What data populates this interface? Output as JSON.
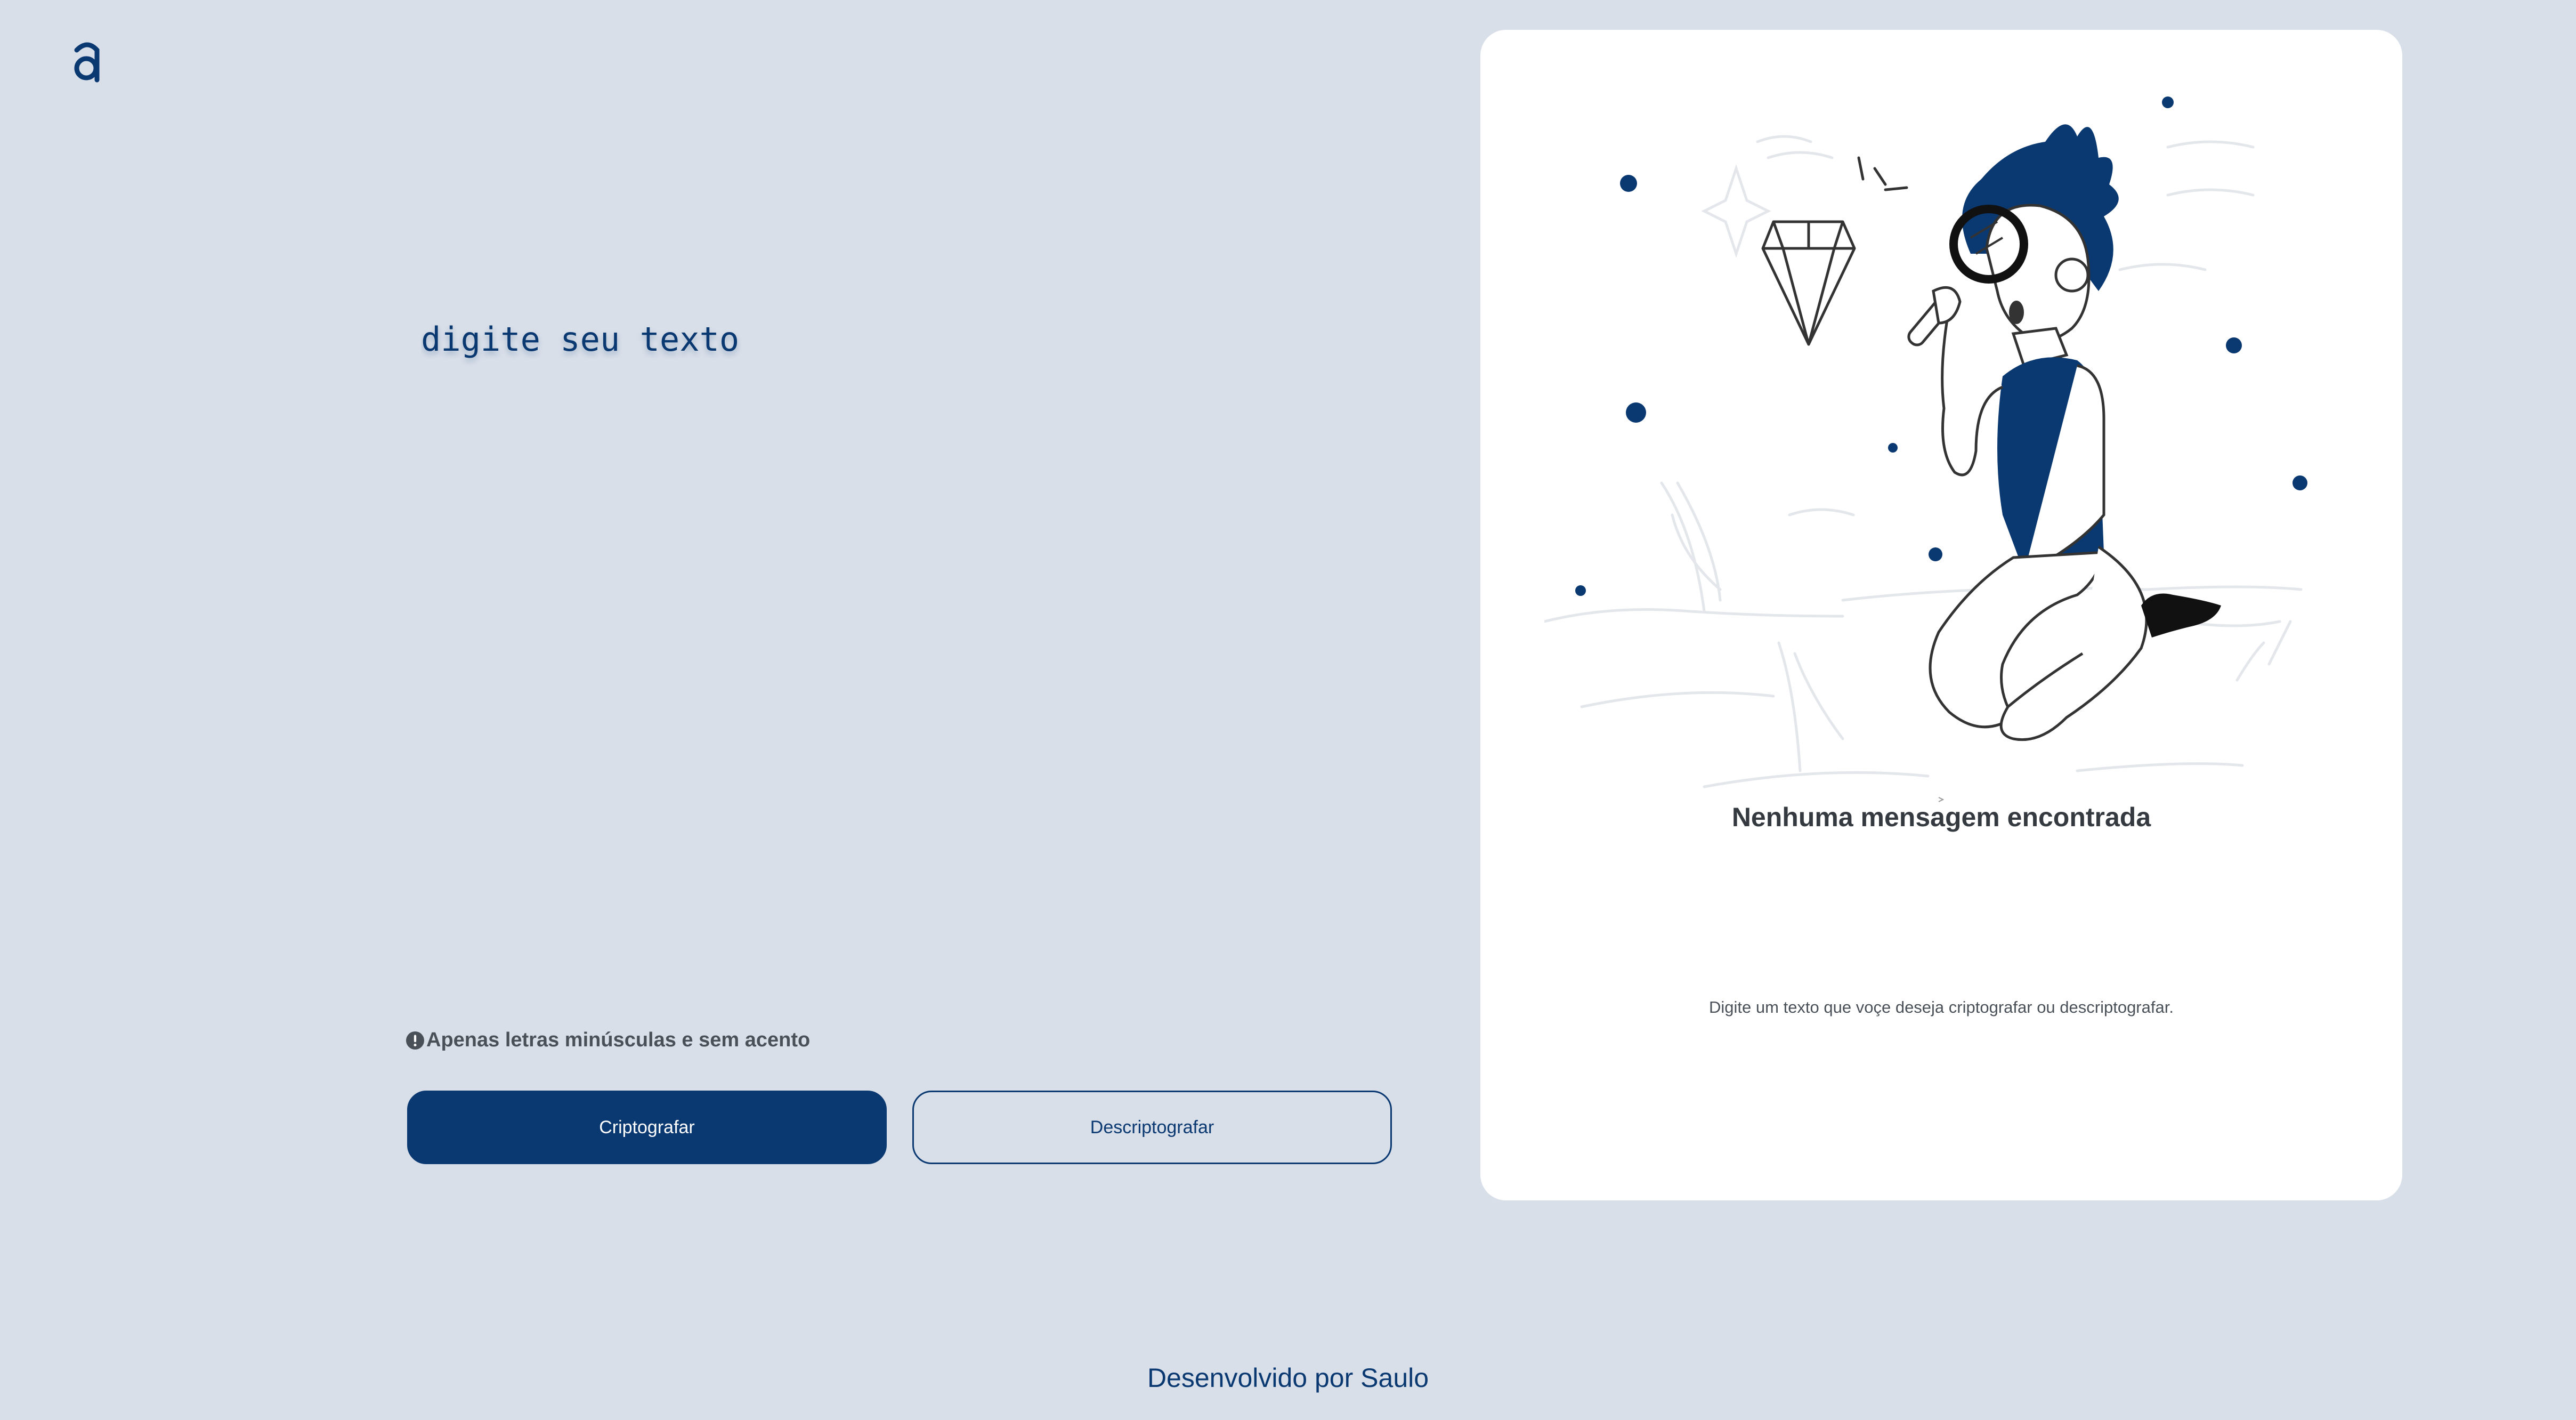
{
  "header": {
    "logo_icon": "alura-logo-icon"
  },
  "input": {
    "placeholder": "digite seu texto",
    "value": ""
  },
  "hint": {
    "icon": "info-circle-icon",
    "text": "Apenas letras minúsculas e sem acento"
  },
  "actions": {
    "encrypt_label": "Criptografar",
    "decrypt_label": "Descriptografar"
  },
  "output_panel": {
    "illustration": "person-with-magnifying-glass-illustration",
    "empty_title": "Nenhuma mensagem encontrada",
    "empty_description": "Digite um texto que voçe deseja criptografar ou descriptografar."
  },
  "footer": {
    "text": "Desenvolvido por Saulo"
  },
  "colors": {
    "background": "#d8dfe9",
    "primary": "#0a3871",
    "panel": "#ffffff",
    "hint_text": "#495057"
  }
}
